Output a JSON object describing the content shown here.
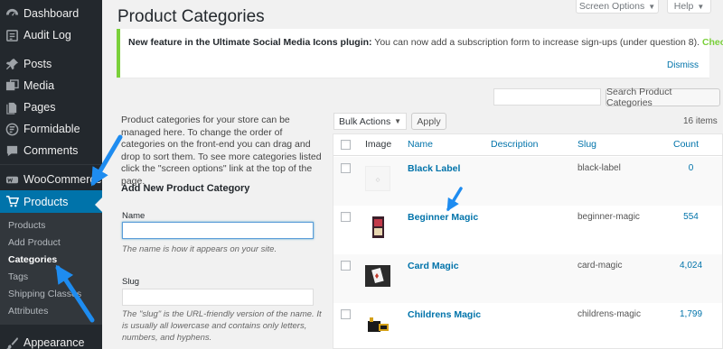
{
  "sidebar": {
    "menu": [
      {
        "label": "Dashboard",
        "icon": "dashboard-icon"
      },
      {
        "label": "Audit Log",
        "icon": "audit-log-icon"
      },
      {
        "label": "Posts",
        "icon": "pin-icon"
      },
      {
        "label": "Media",
        "icon": "media-icon"
      },
      {
        "label": "Pages",
        "icon": "pages-icon"
      },
      {
        "label": "Formidable",
        "icon": "formidable-icon"
      },
      {
        "label": "Comments",
        "icon": "comment-icon"
      },
      {
        "label": "WooCommerce",
        "icon": "woocommerce-icon"
      },
      {
        "label": "Products",
        "icon": "cart-icon"
      },
      {
        "label": "Appearance",
        "icon": "brush-icon"
      }
    ],
    "submenu": [
      "Products",
      "Add Product",
      "Categories",
      "Tags",
      "Shipping Classes",
      "Attributes"
    ]
  },
  "header": {
    "title": "Product Categories",
    "screen_options": "Screen Options",
    "help": "Help"
  },
  "notice": {
    "bold": "New feature in the Ultimate Social Media Icons plugin:",
    "text": " You can now add a subscription form to increase sign-ups (under question 8). ",
    "link": "Check it out",
    "dismiss": "Dismiss"
  },
  "search": {
    "value": "",
    "button": "Search Product Categories"
  },
  "left": {
    "intro": "Product categories for your store can be managed here. To change the order of categories on the front-end you can drag and drop to sort them. To see more categories listed click the \"screen options\" link at the top of the page.",
    "form_title": "Add New Product Category",
    "name_label": "Name",
    "name_value": "",
    "name_desc": "The name is how it appears on your site.",
    "slug_label": "Slug",
    "slug_value": "",
    "slug_desc": "The \"slug\" is the URL-friendly version of the name. It is usually all lowercase and contains only letters, numbers, and hyphens."
  },
  "table": {
    "bulk_actions": "Bulk Actions",
    "apply": "Apply",
    "count": "16 items",
    "columns": [
      "Image",
      "Name",
      "Description",
      "Slug",
      "Count"
    ],
    "rows": [
      {
        "name": "Black Label",
        "slug": "black-label",
        "count": "0"
      },
      {
        "name": "Beginner Magic",
        "slug": "beginner-magic",
        "count": "554"
      },
      {
        "name": "Card Magic",
        "slug": "card-magic",
        "count": "4,024"
      },
      {
        "name": "Childrens Magic",
        "slug": "childrens-magic",
        "count": "1,799"
      }
    ]
  },
  "colors": {
    "sidebar_bg": "#23282d",
    "accent": "#0073aa",
    "notice_border": "#7ad03a",
    "annotation_arrow": "#1e8cf0"
  }
}
